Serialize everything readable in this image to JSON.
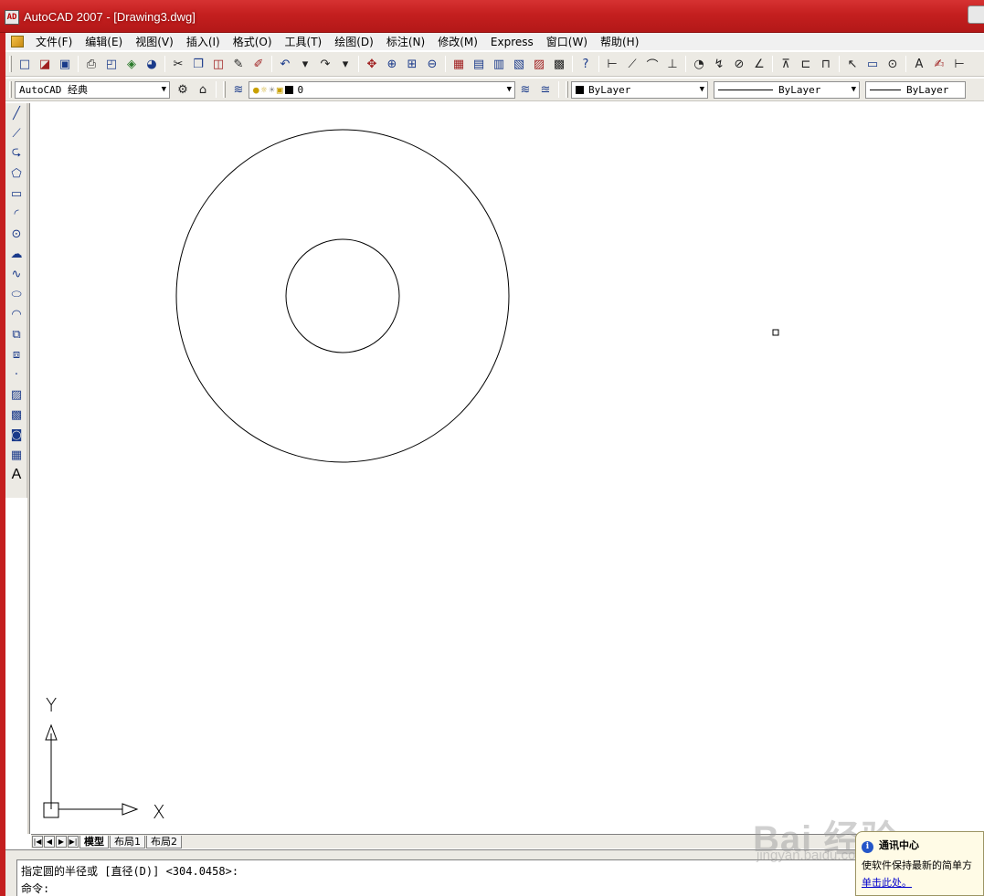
{
  "window": {
    "title": "AutoCAD 2007 - [Drawing3.dwg]",
    "app_icon": "autocad-icon"
  },
  "menu": {
    "items": [
      "文件(F)",
      "编辑(E)",
      "视图(V)",
      "插入(I)",
      "格式(O)",
      "工具(T)",
      "绘图(D)",
      "标注(N)",
      "修改(M)",
      "Express",
      "窗口(W)",
      "帮助(H)"
    ]
  },
  "toolbar2": {
    "workspace": "AutoCAD 经典",
    "layer": "0",
    "color": "ByLayer",
    "linetype": "ByLayer",
    "lineweight": "ByLayer"
  },
  "draw_toolbar": {
    "text_tool": "A"
  },
  "ucs": {
    "x_label": "X",
    "y_label": "Y"
  },
  "layout_tabs": [
    "模型",
    "布局1",
    "布局2"
  ],
  "command": {
    "prompt_line": "指定圆的半径或 [直径(D)] <304.0458>:",
    "input_line": "命令:"
  },
  "notification": {
    "title": "通讯中心",
    "body": "使软件保持最新的简单方",
    "link": "单击此处。"
  },
  "watermark": {
    "main": "Bai 经验",
    "sub": "jingyan.baidu.com"
  }
}
